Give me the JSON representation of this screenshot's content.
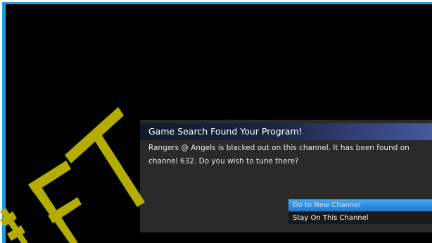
{
  "dialog": {
    "title": "Game Search Found Your Program!",
    "message": "Rangers @ Angels is blacked out on this channel. It has been found on channel 632. Do you wish to tune there?",
    "options": [
      {
        "label": "Go to New Channel",
        "selected": true
      },
      {
        "label": "Stay On This Channel",
        "selected": false
      }
    ]
  },
  "watermark": {
    "text": "LEFT",
    "color": "#b5ac00"
  },
  "colors": {
    "frame_accent": "#1c9fe0",
    "selection": "#2f8ce0",
    "title_gradient_end": "#4a58a0"
  }
}
